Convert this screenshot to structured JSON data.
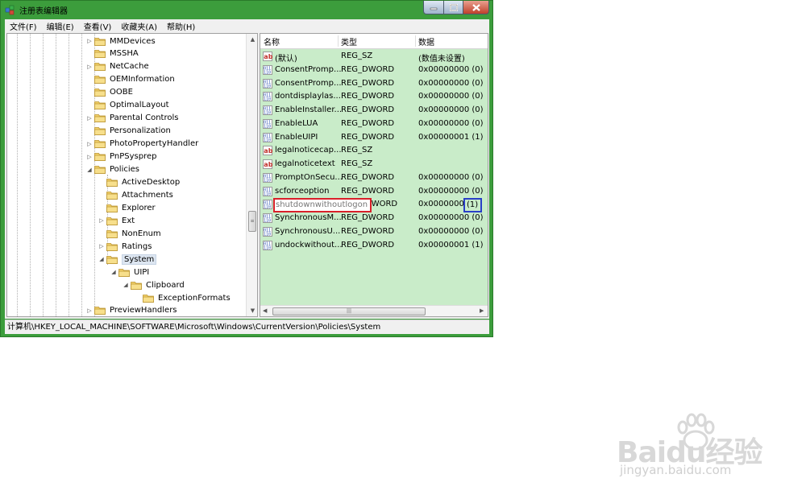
{
  "window": {
    "title": "注册表编辑器"
  },
  "menu": [
    {
      "label": "文件(F)"
    },
    {
      "label": "编辑(E)"
    },
    {
      "label": "查看(V)"
    },
    {
      "label": "收藏夹(A)"
    },
    {
      "label": "帮助(H)"
    }
  ],
  "tree": [
    {
      "label": "MMDevices",
      "arrow": "▷"
    },
    {
      "label": "MSSHA",
      "arrow": ""
    },
    {
      "label": "NetCache",
      "arrow": "▷"
    },
    {
      "label": "OEMInformation",
      "arrow": ""
    },
    {
      "label": "OOBE",
      "arrow": ""
    },
    {
      "label": "OptimalLayout",
      "arrow": ""
    },
    {
      "label": "Parental Controls",
      "arrow": "▷"
    },
    {
      "label": "Personalization",
      "arrow": ""
    },
    {
      "label": "PhotoPropertyHandler",
      "arrow": "▷"
    },
    {
      "label": "PnPSysprep",
      "arrow": "▷"
    },
    {
      "label": "Policies",
      "arrow": "◢"
    },
    {
      "label": "ActiveDesktop",
      "arrow": ""
    },
    {
      "label": "Attachments",
      "arrow": ""
    },
    {
      "label": "Explorer",
      "arrow": ""
    },
    {
      "label": "Ext",
      "arrow": "▷"
    },
    {
      "label": "NonEnum",
      "arrow": ""
    },
    {
      "label": "Ratings",
      "arrow": "▷"
    },
    {
      "label": "System",
      "arrow": "◢"
    },
    {
      "label": "UIPI",
      "arrow": "◢"
    },
    {
      "label": "Clipboard",
      "arrow": "◢"
    },
    {
      "label": "ExceptionFormats",
      "arrow": ""
    },
    {
      "label": "PreviewHandlers",
      "arrow": "▷"
    }
  ],
  "list": {
    "columns": {
      "name": "名称",
      "type": "类型",
      "data": "数据"
    },
    "rows": [
      {
        "name": "(默认)",
        "type": "REG_SZ",
        "data": "(数值未设置)",
        "icon": "ab"
      },
      {
        "name": "ConsentPromp...",
        "type": "REG_DWORD",
        "data": "0x00000000 (0)",
        "icon": "dword"
      },
      {
        "name": "ConsentPromp...",
        "type": "REG_DWORD",
        "data": "0x00000000 (0)",
        "icon": "dword"
      },
      {
        "name": "dontdisplaylas...",
        "type": "REG_DWORD",
        "data": "0x00000000 (0)",
        "icon": "dword"
      },
      {
        "name": "EnableInstaller...",
        "type": "REG_DWORD",
        "data": "0x00000000 (0)",
        "icon": "dword"
      },
      {
        "name": "EnableLUA",
        "type": "REG_DWORD",
        "data": "0x00000000 (0)",
        "icon": "dword"
      },
      {
        "name": "EnableUIPI",
        "type": "REG_DWORD",
        "data": "0x00000001 (1)",
        "icon": "dword"
      },
      {
        "name": "legalnoticecap...",
        "type": "REG_SZ",
        "data": "",
        "icon": "ab"
      },
      {
        "name": "legalnoticetext",
        "type": "REG_SZ",
        "data": "",
        "icon": "ab"
      },
      {
        "name": "PromptOnSecu...",
        "type": "REG_DWORD",
        "data": "0x00000000 (0)",
        "icon": "dword"
      },
      {
        "name": "scforceoption",
        "type": "REG_DWORD",
        "data": "0x00000000 (0)",
        "icon": "dword"
      },
      {
        "name": "shutdownwithoutlogon",
        "type": "DWORD",
        "data": "0x0000000",
        "data_suffix": "(1)",
        "icon": "dword"
      },
      {
        "name": "SynchronousM...",
        "type": "REG_DWORD",
        "data": "0x00000000 (0)",
        "icon": "dword"
      },
      {
        "name": "SynchronousU...",
        "type": "REG_DWORD",
        "data": "0x00000000 (0)",
        "icon": "dword"
      },
      {
        "name": "undockwithout...",
        "type": "REG_DWORD",
        "data": "0x00000001 (1)",
        "icon": "dword"
      }
    ]
  },
  "status": {
    "path": "计算机\\HKEY_LOCAL_MACHINE\\SOFTWARE\\Microsoft\\Windows\\CurrentVersion\\Policies\\System"
  },
  "watermark": {
    "brand": "Baidu经验",
    "url": "jingyan.baidu.com"
  },
  "colors": {
    "window_frame": "#3c9d3c",
    "list_bg": "#c9ecc9",
    "highlight_red": "#d9202a",
    "highlight_blue": "#2a3fc7"
  }
}
